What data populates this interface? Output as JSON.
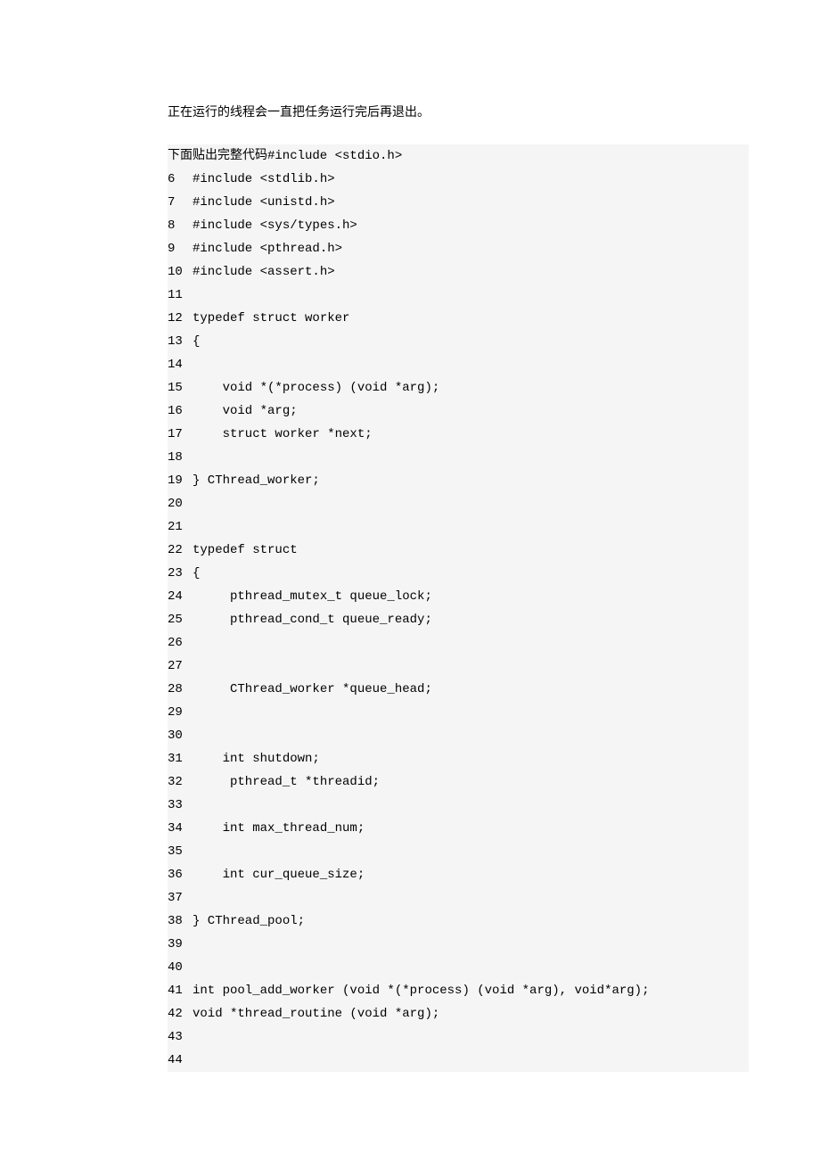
{
  "paragraph": "正在运行的线程会一直把任务运行完后再退出。",
  "intro_text": "下面贴出完整代码",
  "intro_code": "#include <stdio.h>",
  "code": [
    {
      "n": "6",
      "t": "#include <stdlib.h>"
    },
    {
      "n": "7",
      "t": "#include <unistd.h>"
    },
    {
      "n": "8",
      "t": "#include <sys/types.h>"
    },
    {
      "n": "9",
      "t": "#include <pthread.h>"
    },
    {
      "n": "10",
      "t": "#include <assert.h>"
    },
    {
      "n": "11",
      "t": ""
    },
    {
      "n": "12",
      "t": "typedef struct worker"
    },
    {
      "n": "13",
      "t": "{"
    },
    {
      "n": "14",
      "t": ""
    },
    {
      "n": "15",
      "t": "    void *(*process) (void *arg);"
    },
    {
      "n": "16",
      "t": "    void *arg;"
    },
    {
      "n": "17",
      "t": "    struct worker *next;"
    },
    {
      "n": "18",
      "t": ""
    },
    {
      "n": "19",
      "t": "} CThread_worker;"
    },
    {
      "n": "20",
      "t": ""
    },
    {
      "n": "21",
      "t": ""
    },
    {
      "n": "22",
      "t": "typedef struct"
    },
    {
      "n": "23",
      "t": "{"
    },
    {
      "n": "24",
      "t": "     pthread_mutex_t queue_lock;"
    },
    {
      "n": "25",
      "t": "     pthread_cond_t queue_ready;"
    },
    {
      "n": "26",
      "t": ""
    },
    {
      "n": "27",
      "t": ""
    },
    {
      "n": "28",
      "t": "     CThread_worker *queue_head;"
    },
    {
      "n": "29",
      "t": ""
    },
    {
      "n": "30",
      "t": ""
    },
    {
      "n": "31",
      "t": "    int shutdown;"
    },
    {
      "n": "32",
      "t": "     pthread_t *threadid;"
    },
    {
      "n": "33",
      "t": ""
    },
    {
      "n": "34",
      "t": "    int max_thread_num;"
    },
    {
      "n": "35",
      "t": ""
    },
    {
      "n": "36",
      "t": "    int cur_queue_size;"
    },
    {
      "n": "37",
      "t": ""
    },
    {
      "n": "38",
      "t": "} CThread_pool;"
    },
    {
      "n": "39",
      "t": ""
    },
    {
      "n": "40",
      "t": ""
    },
    {
      "n": "41",
      "t": "int pool_add_worker (void *(*process) (void *arg), void*arg);"
    },
    {
      "n": "42",
      "t": "void *thread_routine (void *arg);"
    },
    {
      "n": "43",
      "t": ""
    },
    {
      "n": "44",
      "t": ""
    }
  ]
}
